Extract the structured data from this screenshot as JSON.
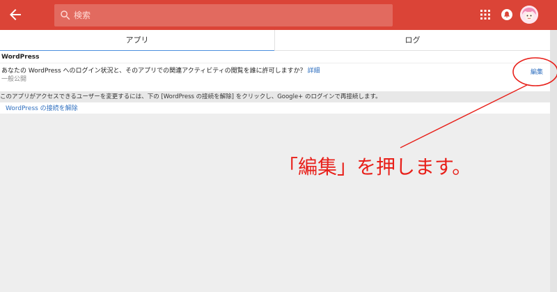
{
  "search": {
    "placeholder": "検索"
  },
  "tabs": [
    {
      "label": "アプリ",
      "active": true
    },
    {
      "label": "ログ",
      "active": false
    }
  ],
  "app": {
    "name": "WordPress",
    "question": "あなたの WordPress へのログイン状況と、そのアプリでの関連アクティビティの閲覧を誰に許可しますか？",
    "detail_link": "詳細",
    "visibility": "一般公開",
    "edit_label": "編集",
    "info": "このアプリがアクセスできるユーザーを変更するには、下の [WordPress の接続を解除] をクリックし、Google+ のログインで再接続します。",
    "disconnect_label": "WordPress の接続を解除"
  },
  "annotation": {
    "text": "「編集」を押します。"
  },
  "colors": {
    "header": "#db4437",
    "link": "#2f6fbf",
    "annotation": "#e8201a",
    "tab_indicator": "#4a8fde"
  }
}
